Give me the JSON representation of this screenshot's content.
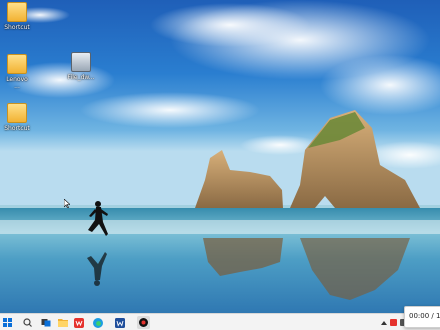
{
  "desktop": {
    "icons": [
      {
        "label": "Shortcut",
        "icon": "folder-icon"
      },
      {
        "label": "Lenovo\n...",
        "icon": "folder-icon"
      },
      {
        "label": "Shortcut",
        "icon": "folder-icon"
      },
      {
        "label": "File_dw...",
        "icon": "app-window-icon"
      }
    ]
  },
  "taskbar": {
    "apps": [
      "start-icon",
      "search-icon",
      "task-view-icon",
      "file-explorer-icon",
      "chat-icon",
      "wps-icon",
      "edge-icon",
      "word-icon",
      "app-icon"
    ],
    "clock": "00:00 / 1..."
  },
  "colors": {
    "taskbar": "#f3f3f3",
    "sky": "#2a78c8",
    "sea": "#3d8fb0"
  }
}
